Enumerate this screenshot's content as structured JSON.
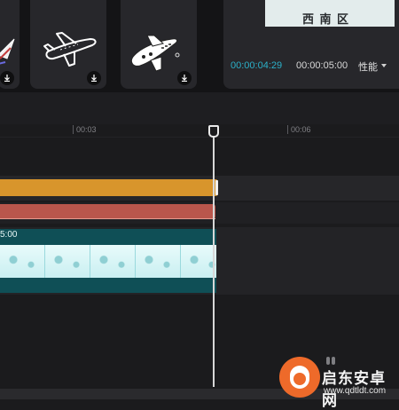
{
  "media_panel": {
    "items": [
      {
        "icon": "paper-plane-sticker-icon",
        "download_icon": "download-icon"
      },
      {
        "icon": "airplane-outline-sticker-icon",
        "download_icon": "download-icon"
      },
      {
        "icon": "airplane-cartoon-sticker-icon",
        "download_icon": "download-icon"
      }
    ]
  },
  "player": {
    "preview_text": "西 南 区",
    "current_time": "00:00:04:29",
    "total_time": "00:00:05:00",
    "performance_label": "性能",
    "dropdown_icon": "caret-down-icon"
  },
  "timeline": {
    "ruler_ticks": [
      "00:03",
      "00:06"
    ],
    "video_clip_label": "5:00",
    "playhead_icon": "playhead-icon"
  },
  "watermark": {
    "title": "启东安卓网",
    "url": "www.qdtldt.com"
  },
  "colors": {
    "accent_time": "#2bb0c8",
    "clip_orange": "#d8952c",
    "clip_red": "#b9564c",
    "clip_video": "#0f4f56"
  }
}
